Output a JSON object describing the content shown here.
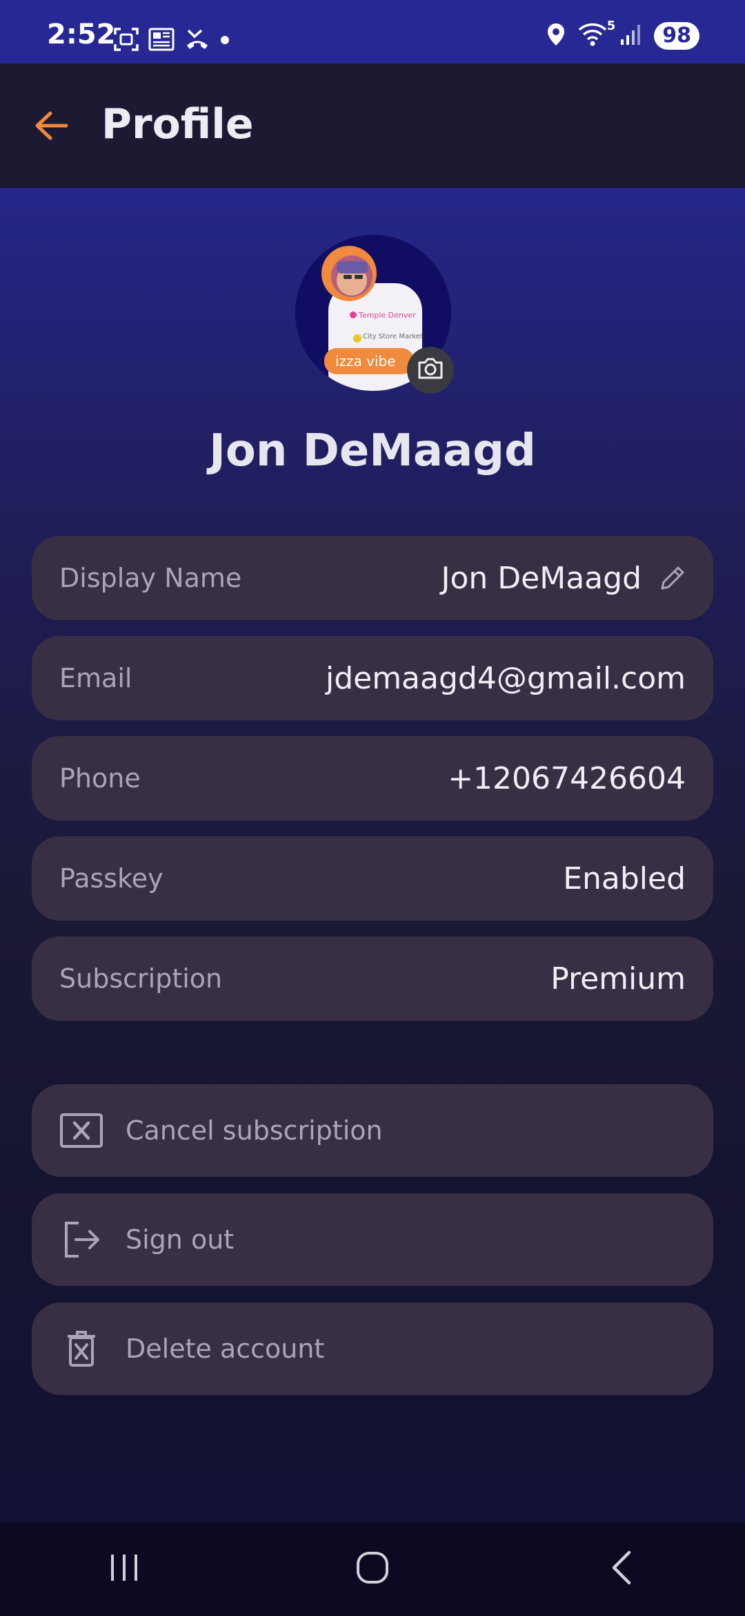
{
  "status_bar": {
    "time": "2:52",
    "signal_label": "5",
    "battery": "98",
    "icons": [
      "screenshot-icon",
      "gallery-icon",
      "news-icon",
      "missed-call-icon",
      "dot-icon",
      "location-icon",
      "wifi-icon",
      "cell-signal-icon"
    ]
  },
  "app_bar": {
    "back_icon": "arrow-left-icon",
    "title": "Profile"
  },
  "profile": {
    "avatar_texts": [
      "Temple Denver",
      "City Store Market",
      "izza vibe"
    ],
    "name": "Jon DeMaagd"
  },
  "fields": [
    {
      "label": "Display Name",
      "value": "Jon DeMaagd",
      "editable": true
    },
    {
      "label": "Email",
      "value": "jdemaagd4@gmail.com"
    },
    {
      "label": "Phone",
      "value": "+12067426604"
    },
    {
      "label": "Passkey",
      "value": "Enabled"
    },
    {
      "label": "Subscription",
      "value": "Premium"
    }
  ],
  "actions": [
    {
      "label": "Cancel subscription",
      "icon": "x-box-icon"
    },
    {
      "label": "Sign out",
      "icon": "logout-icon"
    },
    {
      "label": "Delete account",
      "icon": "trash-icon"
    }
  ],
  "colors": {
    "accent": "#F08A3C",
    "status_bar_bg": "#272894",
    "row_bg": "#392F45"
  }
}
